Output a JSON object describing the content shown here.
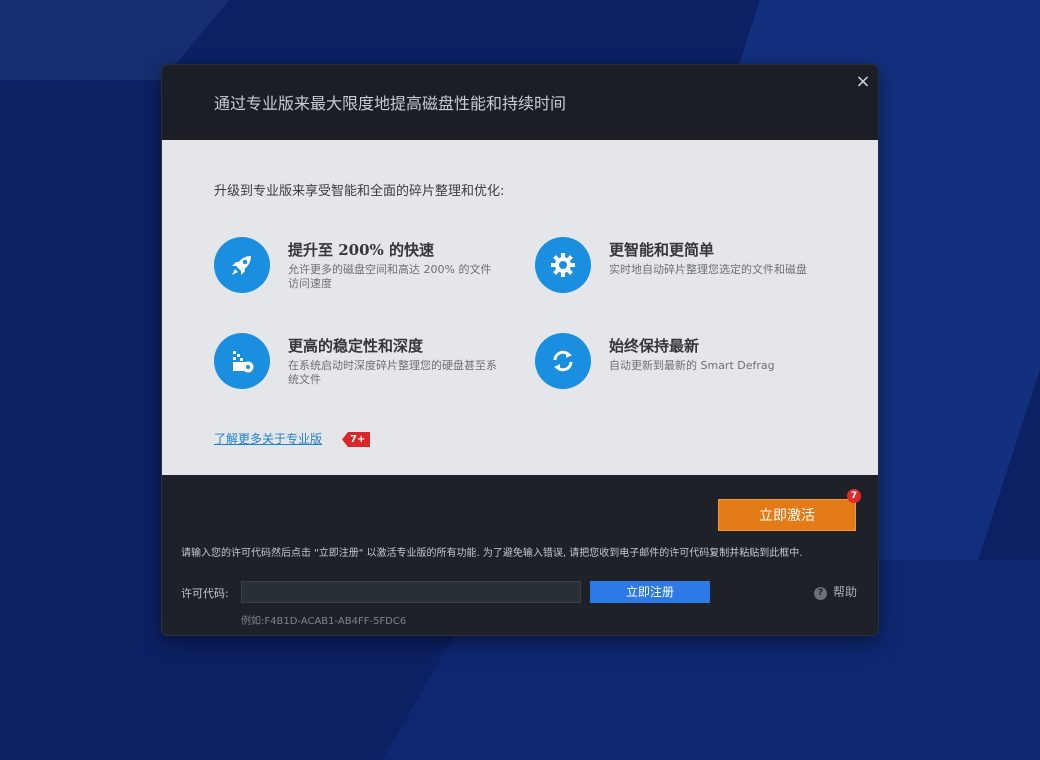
{
  "dialog": {
    "title": "通过专业版来最大限度地提高磁盘性能和持续时间",
    "close_label": "×"
  },
  "content": {
    "intro": "升级到专业版来享受智能和全面的碎片整理和优化:",
    "features": [
      {
        "title": "提升至 200% 的快速",
        "description": "允许更多的磁盘空间和高达 200% 的文件访问速度",
        "icon": "rocket-icon"
      },
      {
        "title": "更智能和更简单",
        "description": "实时地自动碎片整理您选定的文件和磁盘",
        "icon": "gear-icon"
      },
      {
        "title": "更高的稳定性和深度",
        "description": "在系统启动时深度碎片整理您的硬盘甚至系统文件",
        "icon": "disk-defrag-icon"
      },
      {
        "title": "始终保持最新",
        "description": "自动更新到最新的 Smart Defrag",
        "icon": "refresh-icon"
      }
    ],
    "learn_more": "了解更多关于专业版",
    "learn_badge": "7+"
  },
  "footer": {
    "activate_label": "立即激活",
    "activate_badge": "7",
    "instructions": "请输入您的许可代码然后点击 \"立即注册\" 以激活专业版的所有功能. 为了避免输入错误, 请把您收到电子邮件的许可代码复制并粘贴到此框中.",
    "license_label": "许可代码:",
    "license_value": "",
    "register_label": "立即注册",
    "help_label": "帮助",
    "example": "例如:F4B1D-ACAB1-AB4FF-5FDC6"
  },
  "colors": {
    "accent_blue": "#1a8fe0",
    "activate_orange": "#e37b17",
    "register_blue": "#2d7ae6",
    "badge_red": "#d8262b"
  }
}
